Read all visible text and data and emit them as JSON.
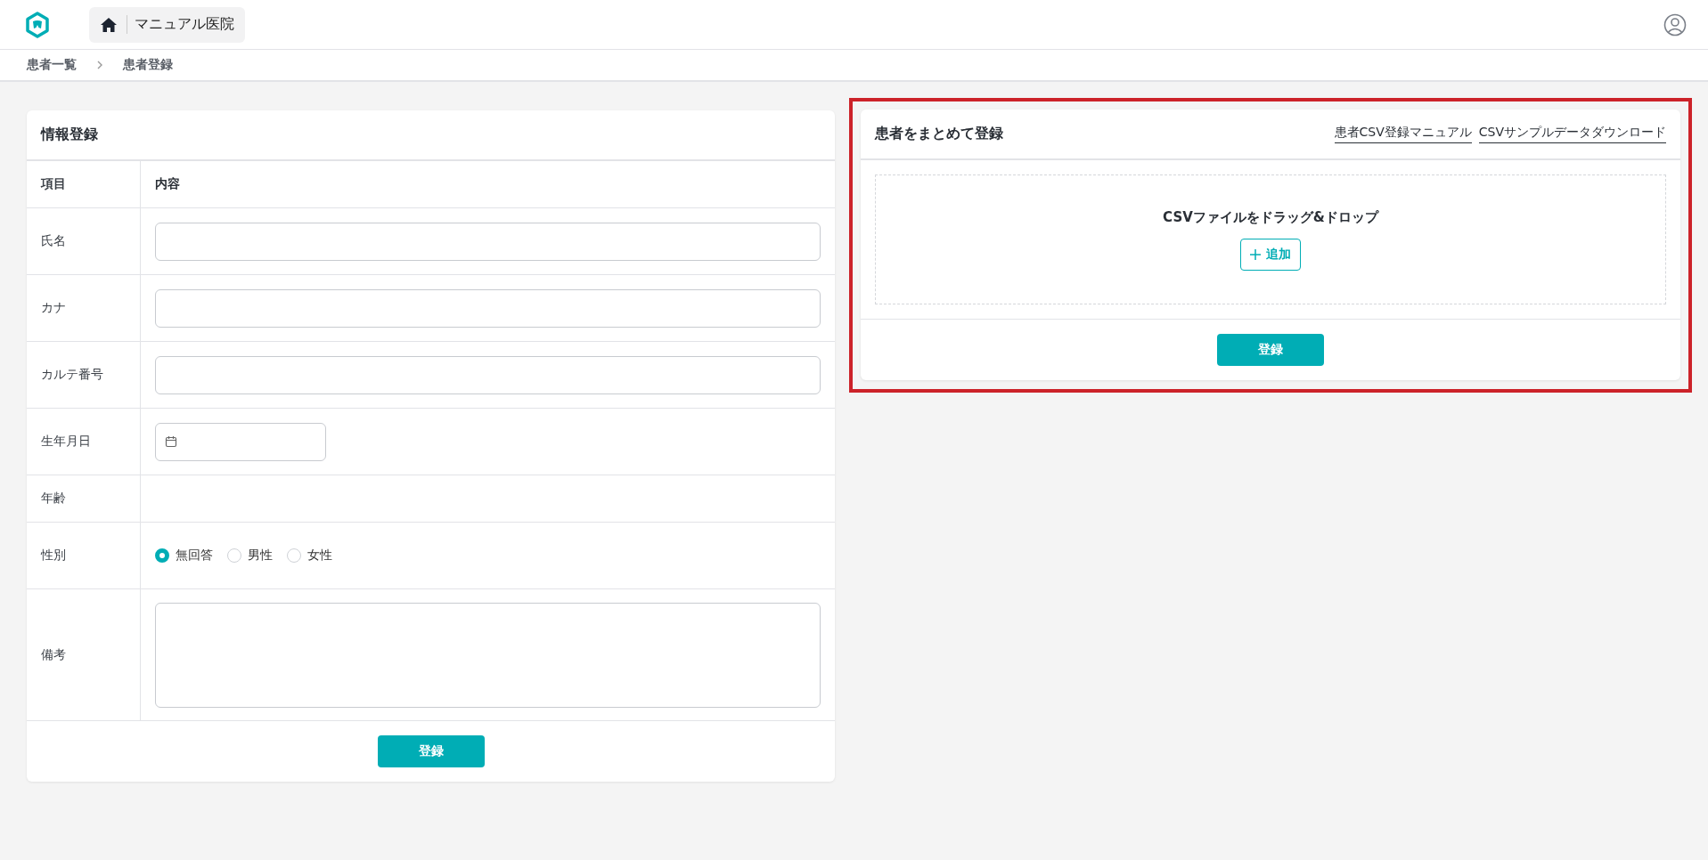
{
  "header": {
    "clinic_name": "マニュアル医院"
  },
  "breadcrumb": [
    "患者一覧",
    "患者登録"
  ],
  "info_form": {
    "title": "情報登録",
    "columns": [
      "項目",
      "内容"
    ],
    "rows": [
      {
        "label": "氏名",
        "kind": "text"
      },
      {
        "label": "カナ",
        "kind": "text"
      },
      {
        "label": "カルテ番号",
        "kind": "text"
      },
      {
        "label": "生年月日",
        "kind": "date"
      },
      {
        "label": "年齢",
        "kind": "plain"
      },
      {
        "label": "性別",
        "kind": "radio",
        "options": [
          {
            "label": "無回答",
            "selected": true
          },
          {
            "label": "男性",
            "selected": false
          },
          {
            "label": "女性",
            "selected": false
          }
        ]
      },
      {
        "label": "備考",
        "kind": "textarea"
      }
    ],
    "submit": "登録"
  },
  "bulk_form": {
    "title": "患者をまとめて登録",
    "highlighted": true,
    "links": [
      "患者CSV登録マニュアル",
      "CSVサンプルデータダウンロード"
    ],
    "dropzone_text": "CSVファイルをドラッグ&ドロップ",
    "add_button": "追加",
    "submit": "登録"
  }
}
